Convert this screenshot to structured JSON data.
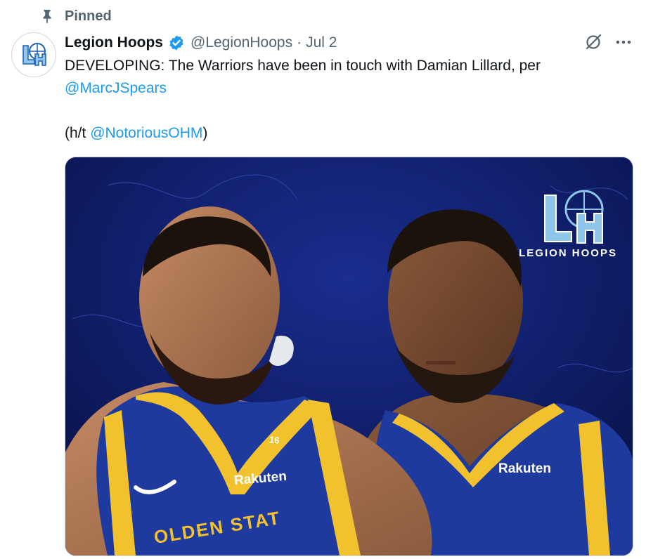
{
  "pinned": {
    "label": "Pinned"
  },
  "author": {
    "display_name": "Legion Hoops",
    "handle": "@LegionHoops",
    "separator": "·",
    "date": "Jul 2"
  },
  "tweet": {
    "line1": "DEVELOPING: The Warriors have been in touch with Damian Lillard, per ",
    "mention1": "@MarcJSpears",
    "ht_prefix": "(h/t ",
    "mention2": "@NotoriousOHM",
    "ht_suffix": ")"
  },
  "media": {
    "brand_name": "LEGION HOOPS",
    "jersey_number": "16",
    "sponsor_left": "Rakuten",
    "sponsor_right": "Rakuten",
    "team_text": "OLDEN STAT"
  },
  "icons": {
    "pin": "pin-icon",
    "verified": "verified-badge-icon",
    "grok": "grok-icon",
    "more": "more-icon"
  },
  "colors": {
    "link": "#1d9bf0",
    "muted": "#536471",
    "warriors_blue": "#1e3a9e",
    "warriors_gold": "#f2c12e"
  }
}
